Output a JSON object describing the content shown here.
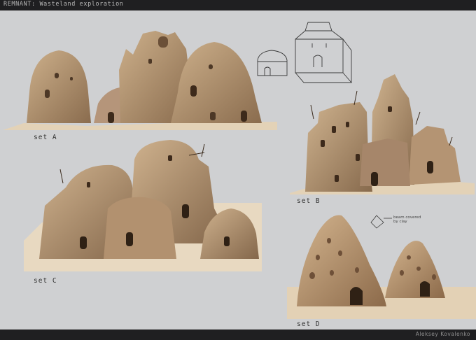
{
  "header": {
    "title": "REMNANT: Wasteland exploration"
  },
  "footer": {
    "author": "Aleksey Kovalenko"
  },
  "sets": {
    "a": {
      "label": "set A"
    },
    "b": {
      "label": "set B"
    },
    "c": {
      "label": "set C"
    },
    "d": {
      "label": "set D",
      "annotation": "beam covered by clay"
    }
  },
  "colors": {
    "background": "#cfd0d2",
    "bars": "#1f1f21",
    "clay_light": "#c7a781",
    "clay_mid": "#a88463",
    "clay_dark": "#6b5038",
    "sand": "#e6d6bd"
  }
}
